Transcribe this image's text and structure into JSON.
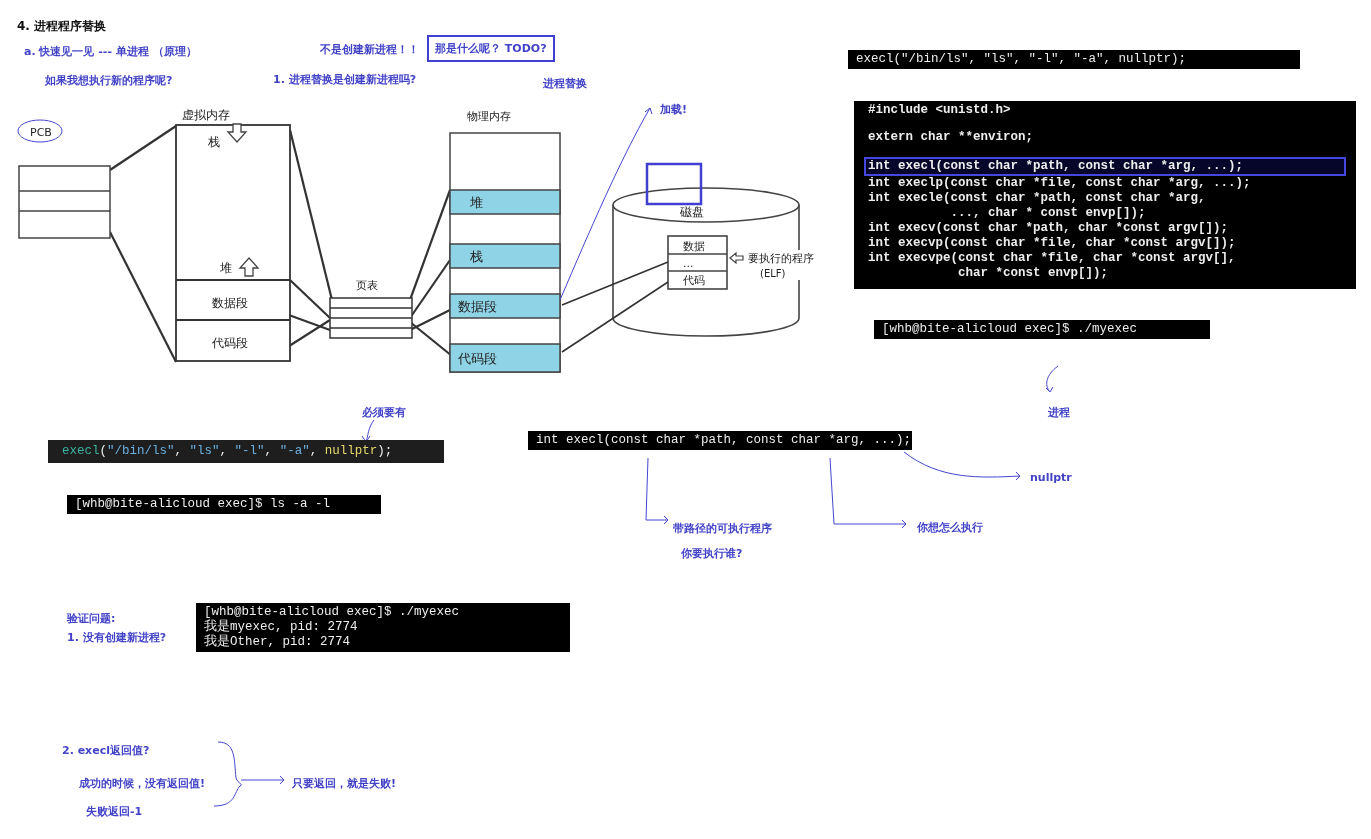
{
  "heading": "4. 进程程序替换",
  "notes": [
    "a. 快速见一见 --- 单进程 （原理）",
    "不是创建新进程！！",
    "如果我想执行新的程序呢?",
    "1. 进程替换是创建新进程吗?",
    "进程替换",
    "加载!",
    "必须要有",
    "进程",
    "nullptr",
    "带路径的可执行程序",
    "你想怎么执行",
    "你要执行谁?",
    "验证问题:",
    "1. 没有创建新进程?",
    "2. execl返回值?",
    "成功的时候，没有返回值!",
    "只要返回，就是失败!",
    "失败返回-1"
  ],
  "boxed_note": "那是什么呢？ TODO?",
  "diagram": {
    "pcb_label": "PCB",
    "virtual_memory": {
      "title": "虚拟内存",
      "regions": [
        "栈",
        "堆",
        "数据段",
        "代码段"
      ]
    },
    "page_table": "页表",
    "physical_memory": {
      "title": "物理内存",
      "regions": [
        "堆",
        "栈",
        "数据段",
        "代码段"
      ]
    },
    "disk": {
      "title": "磁盘",
      "blocks": [
        "数据",
        "...",
        "代码"
      ],
      "program_label": "要执行的程序",
      "format": "(ELF)"
    }
  },
  "code_blocks": [
    {
      "kind": "terminal",
      "lines": [
        "execl(\"/bin/ls\", \"ls\", \"-l\", \"-a\", nullptr);"
      ]
    },
    {
      "kind": "manpage",
      "groups": [
        [
          {
            "text": "#include <unistd.h>",
            "highlighted": false
          }
        ],
        [
          {
            "text": "extern char **environ;",
            "highlighted": false
          }
        ],
        [
          {
            "text": "int execl(const char *path, const char *arg, ...);",
            "highlighted": true
          },
          {
            "text": "int execlp(const char *file, const char *arg, ...);",
            "highlighted": false
          },
          {
            "text": "int execle(const char *path, const char *arg,",
            "highlighted": false
          },
          {
            "text": "           ..., char * const envp[]);",
            "highlighted": false
          },
          {
            "text": "int execv(const char *path, char *const argv[]);",
            "highlighted": false
          },
          {
            "text": "int execvp(const char *file, char *const argv[]);",
            "highlighted": false
          },
          {
            "text": "int execvpe(const char *file, char *const argv[],",
            "highlighted": false
          },
          {
            "text": "            char *const envp[]);",
            "highlighted": false
          }
        ]
      ]
    },
    {
      "kind": "terminal",
      "lines": [
        "[whb@bite-alicloud exec]$ ./myexec"
      ]
    },
    {
      "kind": "colored",
      "tokens": [
        {
          "text": "execl",
          "color": "#3cb4a0"
        },
        {
          "text": "("
        },
        {
          "text": "\"/bin/ls\"",
          "color": "#6cb0e0"
        },
        {
          "text": ", "
        },
        {
          "text": "\"ls\"",
          "color": "#6cb0e0"
        },
        {
          "text": ", "
        },
        {
          "text": "\"-l\"",
          "color": "#6cb0e0"
        },
        {
          "text": ", "
        },
        {
          "text": "\"-a\"",
          "color": "#6cb0e0"
        },
        {
          "text": ", "
        },
        {
          "text": "nullptr",
          "color": "#e6d86a"
        },
        {
          "text": ");"
        }
      ]
    },
    {
      "kind": "terminal",
      "lines": [
        "[whb@bite-alicloud exec]$ ls -a -l"
      ]
    },
    {
      "kind": "terminal",
      "lines": [
        "int execl(const char *path, const char *arg, ...);"
      ]
    },
    {
      "kind": "terminal",
      "lines": [
        "[whb@bite-alicloud exec]$ ./myexec",
        "我是myexec, pid: 2774",
        "我是Other, pid: 2774"
      ]
    }
  ]
}
